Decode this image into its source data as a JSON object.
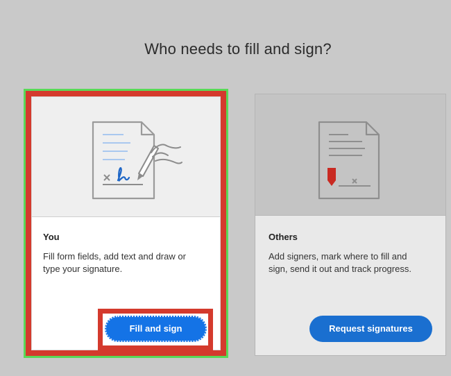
{
  "heading": "Who needs to fill and sign?",
  "cards": [
    {
      "title": "You",
      "description_line1": "Fill form fields, add text and draw or",
      "description_line2": "type your signature.",
      "button_label": "Fill and sign",
      "icon": "document-signature-icon"
    },
    {
      "title": "Others",
      "description_line1": "Add signers, mark where to fill and",
      "description_line2": "sign, send it out and track progress.",
      "button_label": "Request signatures",
      "icon": "document-request-icon"
    }
  ],
  "colors": {
    "background": "#c9c9c9",
    "highlight_green": "#59d957",
    "highlight_red": "#d43a2d",
    "button_blue": "#1473e6"
  }
}
